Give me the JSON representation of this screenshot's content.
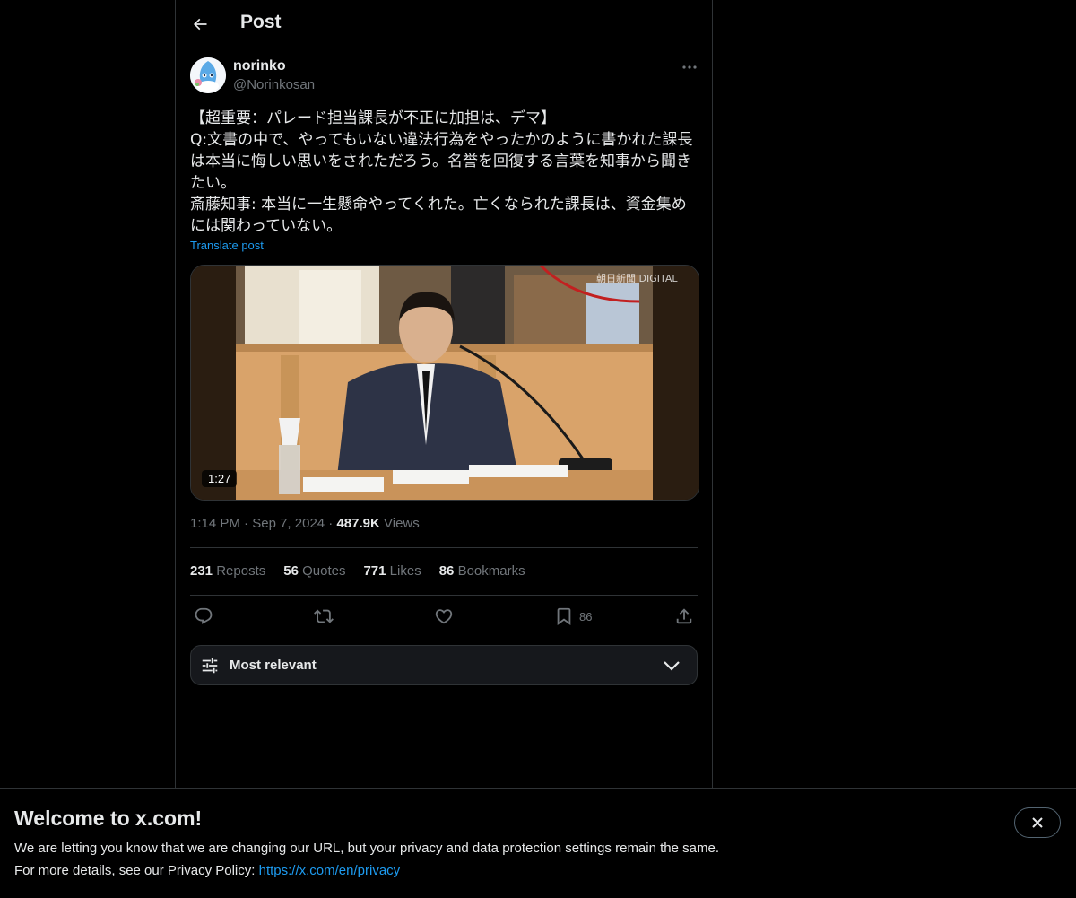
{
  "header": {
    "title": "Post"
  },
  "author": {
    "name": "norinko",
    "handle": "@Norinkosan"
  },
  "post": {
    "text": "【超重要：パレード担当課長が不正に加担は、デマ】\nQ:文書の中で、やってもいない違法行為をやったかのように書かれた課長は本当に悔しい思いをされただろう。名誉を回復する言葉を知事から聞きたい。\n斎藤知事: 本当に一生懸命やってくれた。亡くなられた課長は、資金集めには関わっていない。",
    "translate_label": "Translate post",
    "media": {
      "duration": "1:27",
      "watermark": "朝日新聞 DIGITAL"
    },
    "time": "1:14 PM",
    "separator": "·",
    "date": "Sep 7, 2024",
    "views_count": "487.9K",
    "views_label": "Views"
  },
  "stats": {
    "reposts": {
      "count": "231",
      "label": "Reposts"
    },
    "quotes": {
      "count": "56",
      "label": "Quotes"
    },
    "likes": {
      "count": "771",
      "label": "Likes"
    },
    "bookmarks": {
      "count": "86",
      "label": "Bookmarks"
    }
  },
  "actions": {
    "bookmark_count": "86"
  },
  "sort": {
    "label": "Most relevant"
  },
  "banner": {
    "title": "Welcome to x.com!",
    "line1": "We are letting you know that we are changing our URL, but your privacy and data protection settings remain the same.",
    "line2_prefix": "For more details, see our Privacy Policy:",
    "link": "https://x.com/en/privacy"
  },
  "colors": {
    "accent": "#1d9bf0",
    "background": "#000000",
    "border": "#2f3336",
    "muted": "#71767b",
    "text": "#e7e9ea"
  },
  "icons": [
    "arrow-left-icon",
    "more-icon",
    "reply-icon",
    "repost-icon",
    "like-icon",
    "bookmark-icon",
    "share-icon",
    "sliders-icon",
    "chevron-down-icon",
    "close-icon"
  ]
}
